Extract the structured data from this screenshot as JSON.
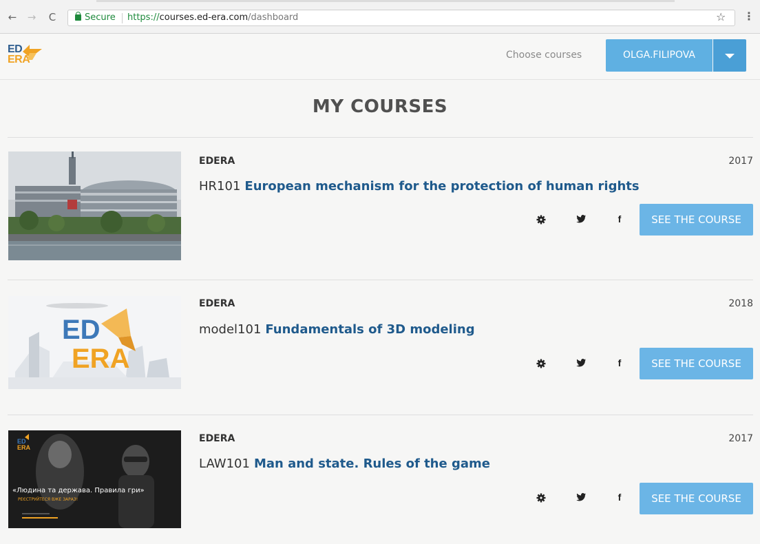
{
  "browser": {
    "secure_label": "Secure",
    "url_scheme": "https://",
    "url_host": "courses.ed-era.com",
    "url_path": "/dashboard",
    "back_icon": "arrow-left-icon",
    "forward_icon": "arrow-right-icon",
    "reload_icon": "reload-icon",
    "bookmark_icon": "star-icon",
    "menu_icon": "kebab-menu-icon"
  },
  "header": {
    "logo_top": "ED",
    "logo_bottom": "ERA",
    "choose_courses": "Choose courses",
    "username": "OLGA.FILIPOVA"
  },
  "main": {
    "title": "MY COURSES",
    "courses": [
      {
        "org": "EDERA",
        "year": "2017",
        "number": "HR101",
        "name": "European mechanism for the protection of human rights",
        "button": "SEE THE COURSE"
      },
      {
        "org": "EDERA",
        "year": "2018",
        "number": "model101",
        "name": "Fundamentals of 3D modeling",
        "button": "SEE THE COURSE",
        "thumb_logo_top": "ED",
        "thumb_logo_bottom": "ERA"
      },
      {
        "org": "EDERA",
        "year": "2017",
        "number": "LAW101",
        "name": "Man and state. Rules of the game",
        "button": "SEE THE COURSE",
        "thumb_title": "«Людина та держава. Правила гри»",
        "thumb_subtitle": "РЕЄСТРУЙТЕСЯ ВЖЕ ЗАРАЗ!",
        "thumb_logo_top": "ED",
        "thumb_logo_bottom": "ERA"
      }
    ]
  },
  "colors": {
    "accent": "#5fb0e2",
    "link": "#1f5a8c",
    "logo_blue": "#2e5d8e",
    "logo_orange": "#f0a324"
  }
}
